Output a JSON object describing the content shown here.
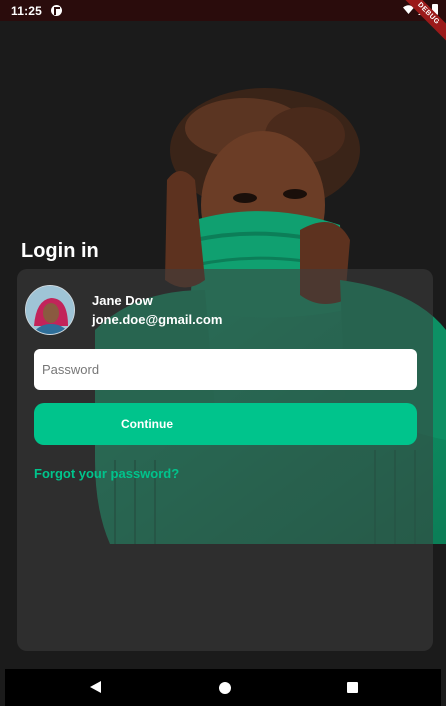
{
  "status_bar": {
    "time": "11:25",
    "debug_label": "DEBUG"
  },
  "screen": {
    "title": "Login in"
  },
  "user": {
    "name": "Jane Dow",
    "email": "jone.doe@gmail.com"
  },
  "form": {
    "password_placeholder": "Password",
    "password_value": "",
    "continue_label": "Continue",
    "forgot_label": "Forgot your password?"
  },
  "colors": {
    "accent": "#00c48c",
    "background": "#1b1b1b",
    "sweater": "#0f9a6a"
  },
  "icons": [
    "app-icon",
    "wifi-icon",
    "signal-icon",
    "battery-icon",
    "back-icon",
    "home-icon",
    "recents-icon"
  ]
}
